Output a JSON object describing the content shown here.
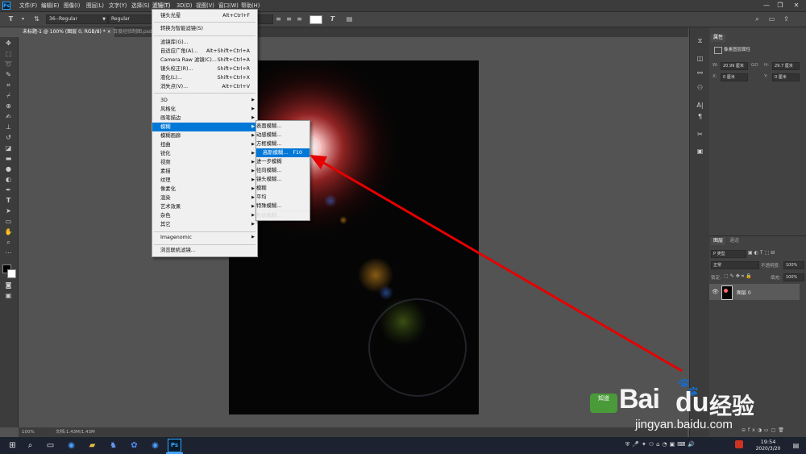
{
  "menubar": {
    "app_logo": "Ps",
    "items": [
      "文件(F)",
      "编辑(E)",
      "图像(I)",
      "图层(L)",
      "文字(Y)",
      "选择(S)",
      "滤镜(T)",
      "3D(D)",
      "视图(V)",
      "窗口(W)",
      "帮助(H)"
    ],
    "active_index": 6
  },
  "options_bar": {
    "font_family": "36--Regular",
    "font_style": "Regular",
    "color_swatch": "#ffffff"
  },
  "tabs": [
    {
      "label": "未标题-1 @ 100% (图层 0, RGB/8) *",
      "close": "×",
      "active": true
    },
    {
      "label": "百度经验制图.psd",
      "active": false
    }
  ],
  "filter_menu": {
    "items": [
      {
        "label": "镜头光晕",
        "shortcut": "Alt+Ctrl+F"
      },
      {
        "sep": true
      },
      {
        "label": "转换为智能滤镜(S)"
      },
      {
        "sep": true
      },
      {
        "label": "滤镜库(G)..."
      },
      {
        "label": "自适应广角(A)...",
        "shortcut": "Alt+Shift+Ctrl+A"
      },
      {
        "label": "Camera Raw 滤镜(C)...",
        "shortcut": "Shift+Ctrl+A"
      },
      {
        "label": "镜头校正(R)...",
        "shortcut": "Shift+Ctrl+R"
      },
      {
        "label": "液化(L)...",
        "shortcut": "Shift+Ctrl+X"
      },
      {
        "label": "消失点(V)...",
        "shortcut": "Alt+Ctrl+V"
      },
      {
        "sep": true
      },
      {
        "label": "3D",
        "submenu": true
      },
      {
        "label": "风格化",
        "submenu": true
      },
      {
        "label": "画笔描边",
        "submenu": true
      },
      {
        "label": "模糊",
        "submenu": true,
        "highlighted": true
      },
      {
        "label": "模糊画廊",
        "submenu": true
      },
      {
        "label": "扭曲",
        "submenu": true
      },
      {
        "label": "锐化",
        "submenu": true
      },
      {
        "label": "视频",
        "submenu": true
      },
      {
        "label": "素描",
        "submenu": true
      },
      {
        "label": "纹理",
        "submenu": true
      },
      {
        "label": "像素化",
        "submenu": true
      },
      {
        "label": "渲染",
        "submenu": true
      },
      {
        "label": "艺术效果",
        "submenu": true
      },
      {
        "label": "杂色",
        "submenu": true
      },
      {
        "label": "其它",
        "submenu": true
      },
      {
        "sep": true
      },
      {
        "label": "Imagenomic",
        "submenu": true
      },
      {
        "sep": true
      },
      {
        "label": "浏览联机滤镜..."
      }
    ]
  },
  "blur_submenu": {
    "items": [
      {
        "label": "表面模糊..."
      },
      {
        "label": "动感模糊..."
      },
      {
        "label": "方框模糊..."
      },
      {
        "label": "高斯模糊...",
        "shortcut": "F10",
        "highlighted": true
      },
      {
        "label": "进一步模糊"
      },
      {
        "label": "径向模糊..."
      },
      {
        "label": "镜头模糊..."
      },
      {
        "label": "模糊"
      },
      {
        "label": "平均"
      },
      {
        "label": "特殊模糊..."
      },
      {
        "label": "形状模糊..."
      }
    ]
  },
  "status_bar": {
    "zoom": "100%",
    "doc_info": "文档:1.43M/1.43M"
  },
  "properties_panel": {
    "tab": "属性",
    "section": "像素图层属性",
    "w_label": "W:",
    "w_value": "20.99 厘米",
    "go_label": "GO",
    "h_label": "H:",
    "h_value": "29.7 厘米",
    "x_label": "X:",
    "x_value": "0 厘米",
    "y_label": "Y:",
    "y_value": "0 厘米"
  },
  "layers_panel": {
    "tabs": [
      "图层",
      "通道"
    ],
    "filter": "P 类型",
    "blend_mode": "正常",
    "opacity_label": "不透明度:",
    "opacity_value": "100%",
    "lock_label": "锁定:",
    "fill_label": "填充:",
    "fill_value": "100%",
    "layer_name": "图层 0"
  },
  "taskbar": {
    "time": "19:54",
    "date": "2020/3/20"
  },
  "watermark": {
    "brand_main": "Bai",
    "brand_du": "du",
    "brand_cn": "经验",
    "badge_text": "知道",
    "url": "jingyan.baidu.com"
  },
  "colors": {
    "accent_highlight": "#0078d7",
    "arrow_red": "#e60000",
    "ps_blue": "#31a8ff"
  }
}
